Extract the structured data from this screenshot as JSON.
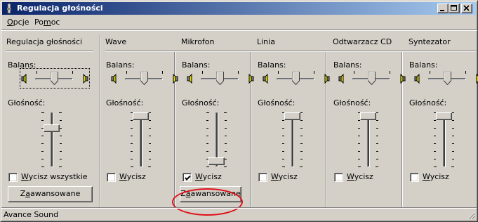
{
  "window": {
    "title": "Regulacja głośności",
    "controls": {
      "minimize_icon": "minimize-icon",
      "maximize_icon": "maximize-icon",
      "close_icon": "close-icon"
    }
  },
  "menu": [
    {
      "label": "Opcje",
      "accel": "O",
      "rest": "pcje"
    },
    {
      "label": "Pomoc",
      "accel": "m",
      "pre": "Po",
      "rest": "oc"
    }
  ],
  "labels": {
    "balance": "Balans:",
    "volume": "Głośność:"
  },
  "master": {
    "title": "Regulacja głośności",
    "balance": 0.5,
    "volume": 0.75,
    "mute": {
      "pre": "",
      "accel": "W",
      "rest": "ycisz wszystkie",
      "checked": false
    },
    "advanced_button": {
      "pre": "Z",
      "accel": "a",
      "rest": "awansowane"
    }
  },
  "channels": [
    {
      "title": "Wave",
      "balance": 0.5,
      "volume": 1.0,
      "mute": {
        "pre": "",
        "accel": "W",
        "rest": "ycisz",
        "checked": false
      }
    },
    {
      "title": "Mikrofon",
      "balance": 0.5,
      "volume": 0.05,
      "mute": {
        "pre": "",
        "accel": "W",
        "rest": "ycisz",
        "checked": true
      },
      "advanced_button": {
        "pre": "Z",
        "accel": "a",
        "rest": "awansowane"
      }
    },
    {
      "title": "Linia",
      "balance": 0.5,
      "volume": 1.0,
      "mute": {
        "pre": "",
        "accel": "W",
        "rest": "ycisz",
        "checked": false
      }
    },
    {
      "title": "Odtwarzacz CD",
      "balance": 0.5,
      "volume": 1.0,
      "mute": {
        "pre": "",
        "accel": "W",
        "rest": "ycisz",
        "checked": false
      }
    },
    {
      "title": "Syntezator",
      "balance": 0.5,
      "volume": 1.0,
      "mute": {
        "pre": "",
        "accel": "W",
        "rest": "ycisz",
        "checked": false
      }
    }
  ],
  "status": "Avance Sound",
  "colors": {
    "titlebar_start": "#0a246a",
    "titlebar_end": "#a6caf0",
    "face": "#d4d0c8",
    "annotation": "#e0101a",
    "speaker": "#e8e000"
  }
}
